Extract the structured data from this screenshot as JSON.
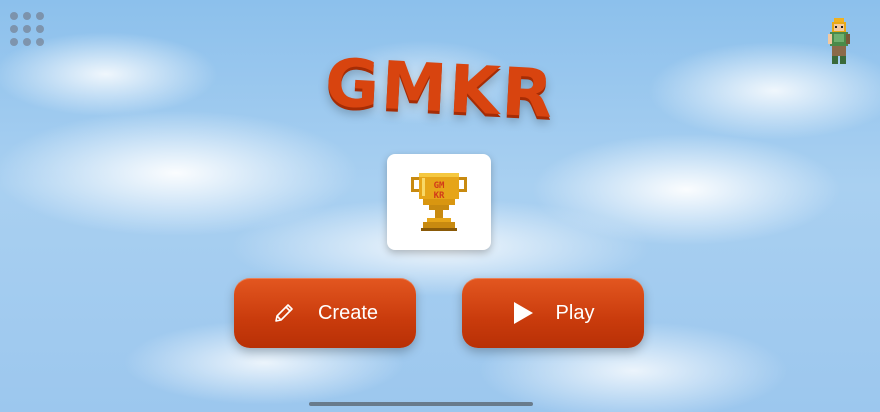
{
  "app": {
    "title": "GMKR"
  },
  "trophy": {
    "label_line1": "GM",
    "label_line2": "KR"
  },
  "buttons": {
    "create_label": "Create",
    "play_label": "Play"
  },
  "icons": {
    "menu": "grid-menu-icon",
    "avatar": "player-avatar",
    "create": "pencil-icon",
    "play": "play-icon",
    "trophy": "trophy-icon"
  },
  "colors": {
    "accent": "#d8440f",
    "button": "#c93b0c",
    "trophy_gold": "#e6a519"
  }
}
